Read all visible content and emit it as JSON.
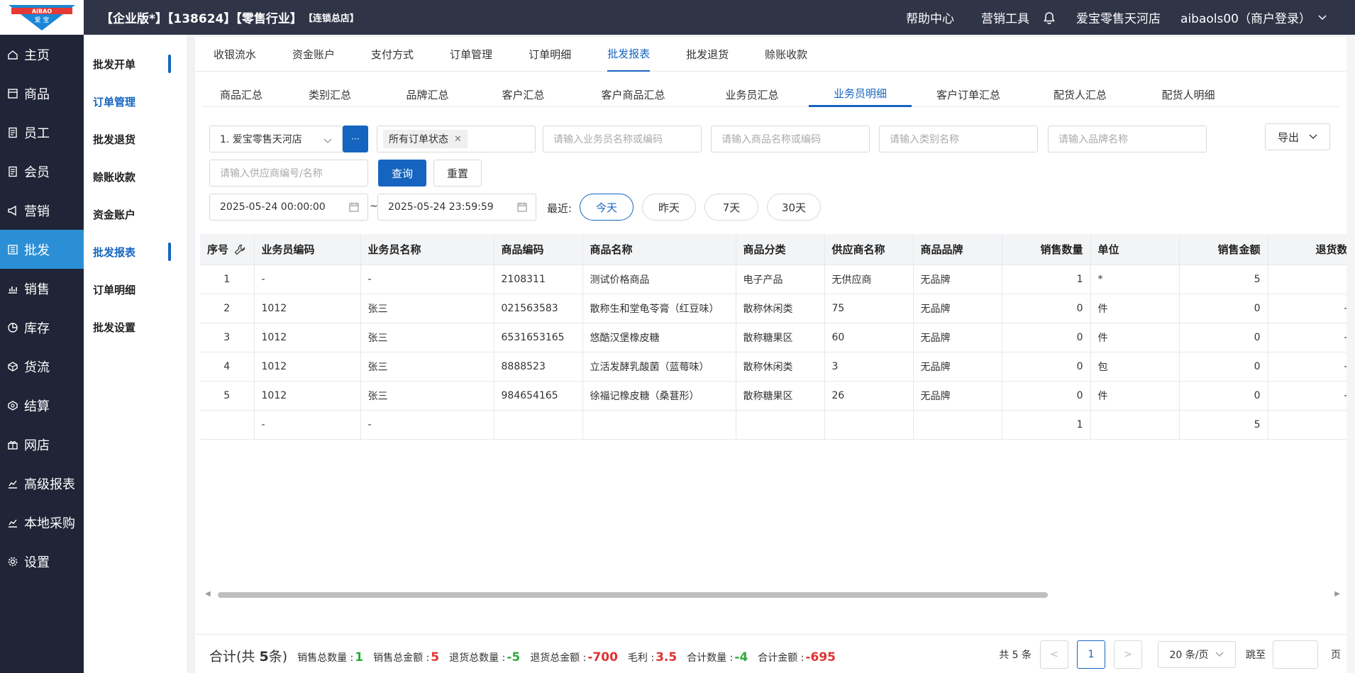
{
  "header": {
    "logo_text_top": "AIBAO",
    "logo_text_bottom": "爱 宝",
    "title_main": "【企业版*】【138624】【零售行业】",
    "title_small": "【连锁总店】",
    "help": "帮助中心",
    "marketing_tools": "营销工具",
    "store": "爱宝零售天河店",
    "user": "aibaols00（商户登录）"
  },
  "leftnav": {
    "items": [
      {
        "label": "主页",
        "icon": "home-icon"
      },
      {
        "label": "商品",
        "icon": "product-icon"
      },
      {
        "label": "员工",
        "icon": "staff-icon"
      },
      {
        "label": "会员",
        "icon": "member-icon"
      },
      {
        "label": "营销",
        "icon": "megaphone-icon"
      },
      {
        "label": "批发",
        "icon": "wholesale-icon"
      },
      {
        "label": "销售",
        "icon": "sales-chart-icon"
      },
      {
        "label": "库存",
        "icon": "inventory-icon"
      },
      {
        "label": "货流",
        "icon": "logistics-icon"
      },
      {
        "label": "结算",
        "icon": "settlement-icon"
      },
      {
        "label": "网店",
        "icon": "gift-icon"
      },
      {
        "label": "高级报表",
        "icon": "report-icon"
      },
      {
        "label": "本地采购",
        "icon": "purchase-icon"
      },
      {
        "label": "设置",
        "icon": "gear-icon"
      }
    ],
    "active_index": 5
  },
  "subnav": {
    "items": [
      "批发开单",
      "订单管理",
      "批发退货",
      "赊账收款",
      "资金账户",
      "批发报表",
      "订单明细",
      "批发设置"
    ]
  },
  "tabs1": [
    "收银流水",
    "资金账户",
    "支付方式",
    "订单管理",
    "订单明细",
    "批发报表",
    "批发退货",
    "赊账收款"
  ],
  "tabs2": [
    "商品汇总",
    "类别汇总",
    "品牌汇总",
    "客户汇总",
    "客户商品汇总",
    "业务员汇总",
    "业务员明细",
    "客户订单汇总",
    "配货人汇总",
    "配货人明细"
  ],
  "filters": {
    "store": "1. 爱宝零售天河店",
    "more_btn": "···",
    "order_status": "所有订单状态",
    "salesperson_ph": "请输入业务员名称或编码",
    "product_ph": "请输入商品名称或编码",
    "category_ph": "请输入类别名称",
    "brand_ph": "请输入品牌名称",
    "export": "导出",
    "supplier_ph": "请输入供应商编号/名称",
    "query": "查询",
    "reset": "重置",
    "start_date": "2025-05-24 00:00:00",
    "date_sep": "~",
    "end_date": "2025-05-24 23:59:59",
    "recent_label": "最近:",
    "recent": [
      "今天",
      "昨天",
      "7天",
      "30天"
    ]
  },
  "table": {
    "headers": [
      "序号",
      "业务员编码",
      "业务员名称",
      "商品编码",
      "商品名称",
      "商品分类",
      "供应商名称",
      "商品品牌",
      "销售数量",
      "单位",
      "销售金额",
      "退货数"
    ],
    "rows": [
      [
        "1",
        "-",
        "-",
        "2108311",
        "测试价格商品",
        "电子产品",
        "无供应商",
        "无品牌",
        "1",
        "*",
        "5",
        ""
      ],
      [
        "2",
        "1012",
        "张三",
        "021563583",
        "散称生和堂龟苓膏（红豆味）",
        "散称休闲类",
        "75",
        "无品牌",
        "0",
        "件",
        "0",
        "-"
      ],
      [
        "3",
        "1012",
        "张三",
        "6531653165",
        "悠酷汉堡橡皮糖",
        "散称糖果区",
        "60",
        "无品牌",
        "0",
        "件",
        "0",
        "-"
      ],
      [
        "4",
        "1012",
        "张三",
        "8888523",
        "立活发酵乳酸菌（蓝莓味）",
        "散称休闲类",
        "3",
        "无品牌",
        "0",
        "包",
        "0",
        "-"
      ],
      [
        "5",
        "1012",
        "张三",
        "984654165",
        "徐福记橡皮糖（桑葚形）",
        "散称糖果区",
        "26",
        "无品牌",
        "0",
        "件",
        "0",
        "-"
      ]
    ],
    "total_row": [
      "",
      "-",
      "-",
      "",
      "",
      "",
      "",
      "",
      "1",
      "",
      "5",
      ""
    ]
  },
  "summary": {
    "title_pre": "合计(共 ",
    "count": "5",
    "title_post": "条)",
    "items": [
      {
        "label": "销售总数量 : ",
        "value": "1",
        "color": "green"
      },
      {
        "label": "销售总金额 : ",
        "value": "5",
        "color": "red"
      },
      {
        "label": "退货总数量 : ",
        "value": "-5",
        "color": "green"
      },
      {
        "label": "退货总金额 : ",
        "value": "-700",
        "color": "red"
      },
      {
        "label": "毛利 : ",
        "value": "3.5",
        "color": "red"
      },
      {
        "label": "合计数量 : ",
        "value": "-4",
        "color": "green"
      },
      {
        "label": "合计金额 : ",
        "value": "-695",
        "color": "red"
      }
    ]
  },
  "pager": {
    "total": "共 5 条",
    "prev": "<",
    "current": "1",
    "next": ">",
    "page_size": "20 条/页",
    "jump": "跳至",
    "page": "页"
  }
}
